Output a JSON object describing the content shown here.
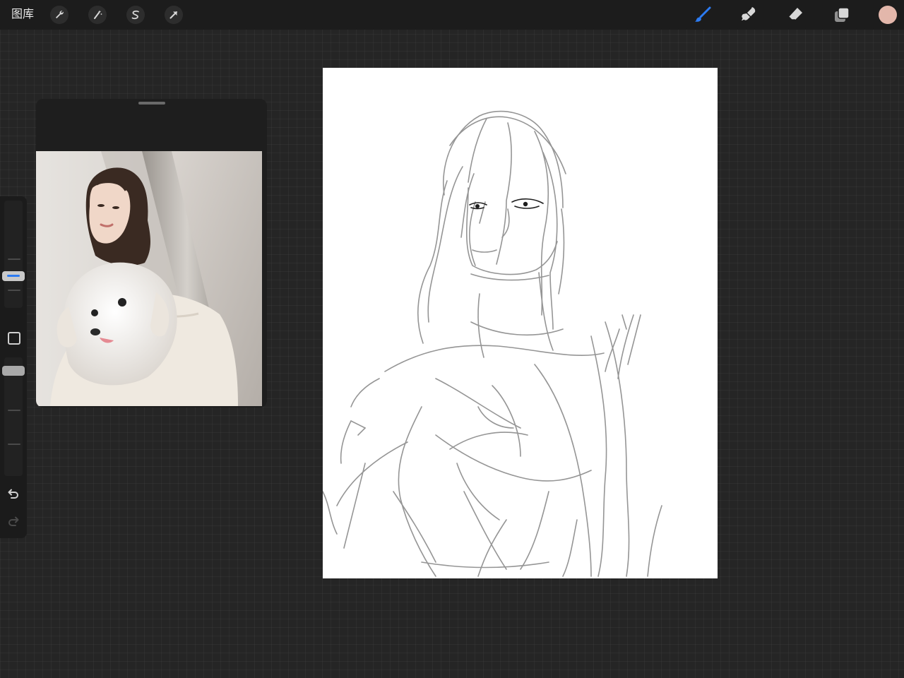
{
  "topbar": {
    "gallery_label": "图库",
    "left_tools": [
      {
        "icon": "wrench-icon",
        "name": "actions"
      },
      {
        "icon": "magic-wand-icon",
        "name": "adjustments"
      },
      {
        "icon": "selection-icon",
        "name": "selection"
      },
      {
        "icon": "arrow-transform-icon",
        "name": "transform"
      }
    ],
    "right_tools": [
      {
        "icon": "brush-icon",
        "name": "paint",
        "active": true
      },
      {
        "icon": "smudge-icon",
        "name": "smudge",
        "active": false
      },
      {
        "icon": "eraser-icon",
        "name": "erase",
        "active": false
      },
      {
        "icon": "layers-icon",
        "name": "layers",
        "active": false
      }
    ],
    "current_color": "#e3b7ab",
    "active_tool_color": "#2c7bf2"
  },
  "sidebar": {
    "brush_size_slider": "brush-size",
    "opacity_slider": "opacity",
    "undo_icon": "undo-icon",
    "redo_icon": "redo-icon"
  },
  "reference": {
    "window": "reference-window",
    "image": "reference-photo"
  },
  "canvas": {
    "background": "#ffffff",
    "sketch_color": "#8a8a8a"
  }
}
